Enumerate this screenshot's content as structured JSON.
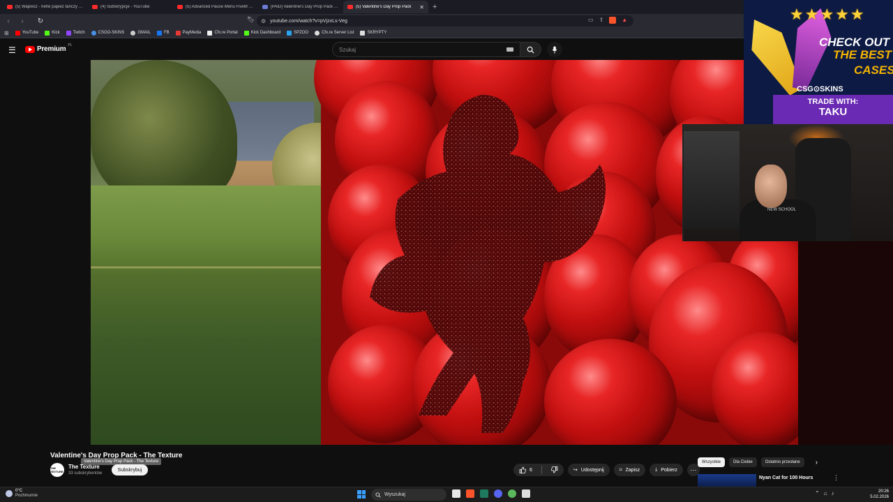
{
  "browser": {
    "tabs": [
      {
        "label": "(5) Wapiesz - hehe papież tańczy - YouTube",
        "active": false
      },
      {
        "label": "(4) Subskrypcje - YouTube",
        "active": false
      },
      {
        "label": "(5) Advanced Pause Menu FiveM Script",
        "active": false
      },
      {
        "label": "[PAID] Valentine's Day Prop Pack - The Texture",
        "active": false
      },
      {
        "label": "(5) Valentine's Day Prop Pack",
        "active": true
      }
    ],
    "new_tab": "+",
    "url": "youtube.com/watch?v=pVjzxLs-Veg",
    "bookmarks": [
      {
        "label": "YouTube",
        "color": "#ff0000"
      },
      {
        "label": "Kick",
        "color": "#53fc18"
      },
      {
        "label": "Twitch",
        "color": "#9146ff"
      },
      {
        "label": "CSGO-SKINS",
        "color": "#4a90e2"
      },
      {
        "label": "GMAIL",
        "color": "#cccccc"
      },
      {
        "label": "FB",
        "color": "#1877f2"
      },
      {
        "label": "PayMedia",
        "color": "#e53935"
      },
      {
        "label": "Cfx.re Portal",
        "color": "#f1f1f1"
      },
      {
        "label": "Kick Dashboard",
        "color": "#53fc18"
      },
      {
        "label": "SPZOO",
        "color": "#2aa3ef"
      },
      {
        "label": "Cfx.re Server List",
        "color": "#dddddd"
      },
      {
        "label": "SKRYPTY",
        "color": "#dddddd"
      }
    ]
  },
  "youtube": {
    "logo_word": "Premium",
    "logo_country": "PL",
    "search_placeholder": "Szukaj"
  },
  "ad": {
    "line1": "CHECK OUT",
    "line2": "THE BEST",
    "line3": "CASES",
    "brand": "CSG⊙SKINS",
    "trade_label": "TRADE WITH:",
    "trade_name": "TAKU",
    "stars": "★★★★★"
  },
  "video": {
    "title": "Valentine's Day Prop Pack - The Texture",
    "tooltip": "Valentine's Day Prop Pack - The Texture",
    "channel_name": "The Texture",
    "channel_avatar_text": "THE TEXTURE",
    "subscribers": "33 subskrybentów",
    "subscribe_label": "Subskrybuj",
    "likes": "6",
    "share_label": "Udostępnij",
    "save_label": "Zapisz",
    "download_label": "Pobierz",
    "more_label": "⋯"
  },
  "webcam": {
    "shirt_text": "NEW SCHOOL"
  },
  "sidebar_chips": [
    {
      "label": "Wszystkie",
      "active": true
    },
    {
      "label": "Dla Ciebie",
      "active": false
    },
    {
      "label": "Ostatnio przesłane",
      "active": false
    }
  ],
  "recommendation": {
    "title": "Nyan Cat for 100 Hours"
  },
  "taskbar": {
    "weather_temp": "0°C",
    "weather_desc": "Pochmurnie",
    "search_label": "Wyszukaj",
    "time": "20:26",
    "date": "5.02.2026"
  }
}
